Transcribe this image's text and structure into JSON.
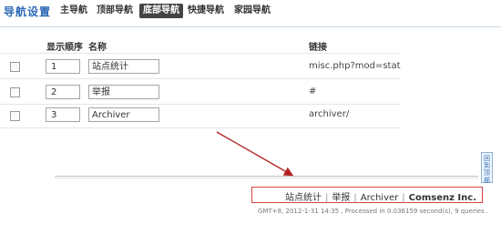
{
  "nav": {
    "title": "导航设置",
    "tabs": [
      {
        "label": "主导航",
        "active": false
      },
      {
        "label": "顶部导航",
        "active": false
      },
      {
        "label": "底部导航",
        "active": true
      },
      {
        "label": "快捷导航",
        "active": false
      },
      {
        "label": "家园导航",
        "active": false
      }
    ]
  },
  "table": {
    "headers": {
      "order": "显示顺序",
      "name": "名称",
      "link": "链接"
    },
    "rows": [
      {
        "order": "1",
        "name": "站点统计",
        "link": "misc.php?mod=stat"
      },
      {
        "order": "2",
        "name": "举报",
        "link": "#"
      },
      {
        "order": "3",
        "name": "Archiver",
        "link": "archiver/"
      }
    ]
  },
  "side_button": {
    "label": "回到顶部"
  },
  "footer": {
    "links": [
      "站点统计",
      "举报",
      "Archiver"
    ],
    "separator": "|",
    "brand": "Comsenz Inc."
  },
  "processed_text": "GMT+8, 2012-1-31 14:35 , Processed in 0.036159 second(s), 9 queries .",
  "colors": {
    "annotation": "#b22222",
    "footer_box": "#d94444",
    "title": "#2b68b4"
  }
}
